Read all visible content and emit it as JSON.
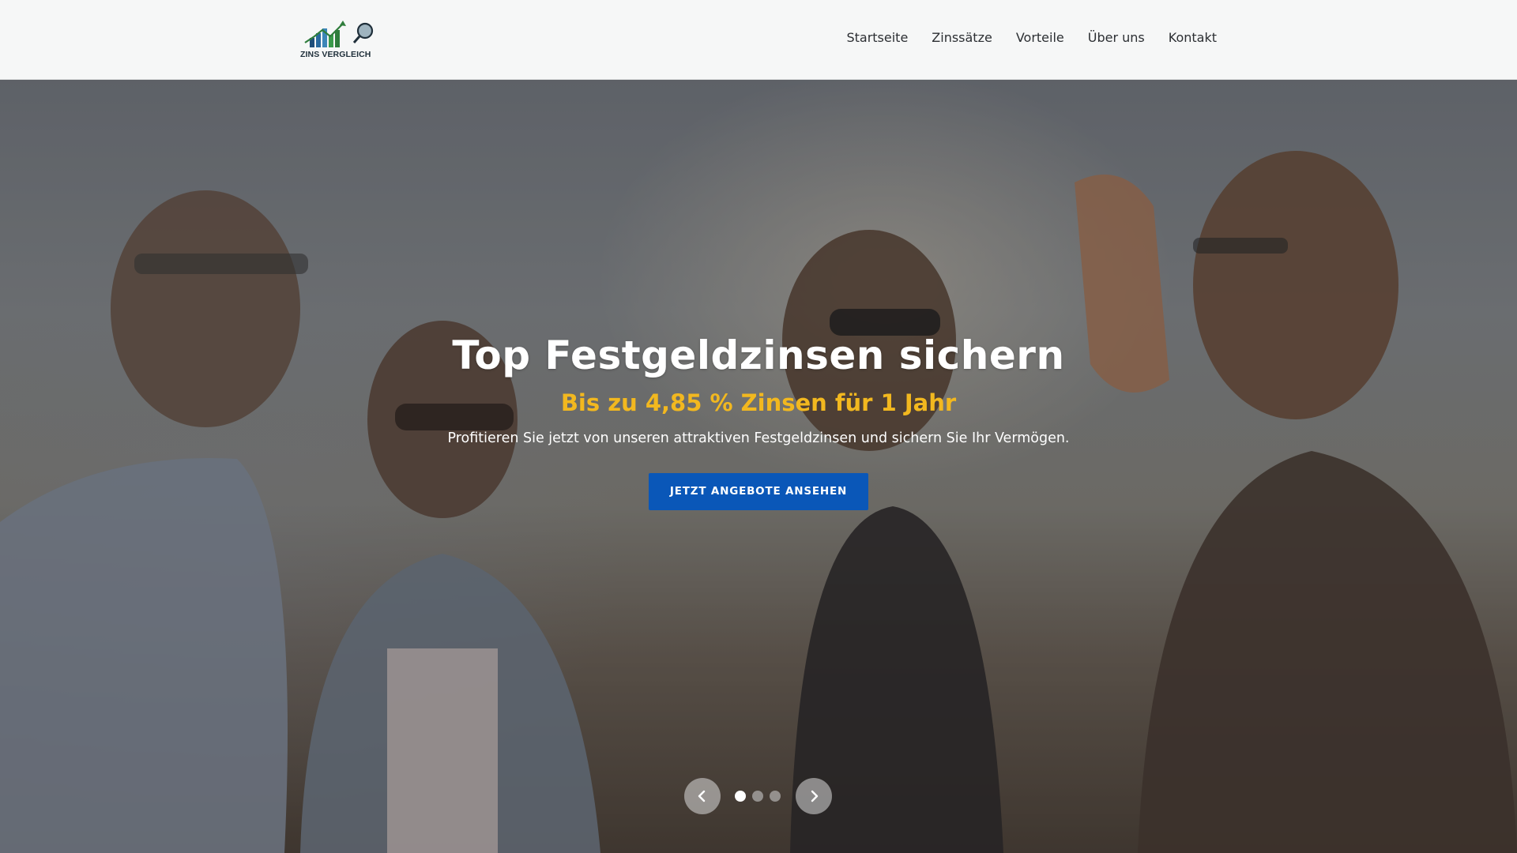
{
  "header": {
    "logo_text": "ZINS VERGLEICH",
    "nav": [
      {
        "label": "Startseite"
      },
      {
        "label": "Zinssätze"
      },
      {
        "label": "Vorteile"
      },
      {
        "label": "Über uns"
      },
      {
        "label": "Kontakt"
      }
    ]
  },
  "hero": {
    "title": "Top Festgeldzinsen sichern",
    "subtitle": "Bis zu 4,85 % Zinsen für 1 Jahr",
    "text": "Profitieren Sie jetzt von unseren attraktiven Festgeldzinsen und sichern Sie Ihr Vermögen.",
    "cta_label": "JETZT ANGEBOTE ANSEHEN"
  },
  "slider": {
    "prev_icon": "chevron-left-icon",
    "next_icon": "chevron-right-icon",
    "slide_count": 3,
    "active_slide": 1
  },
  "colors": {
    "brand_blue": "#0a57b8",
    "accent_yellow": "#f2b81f",
    "header_bg": "#f6f7f7",
    "nav_text": "#2c2f33"
  }
}
